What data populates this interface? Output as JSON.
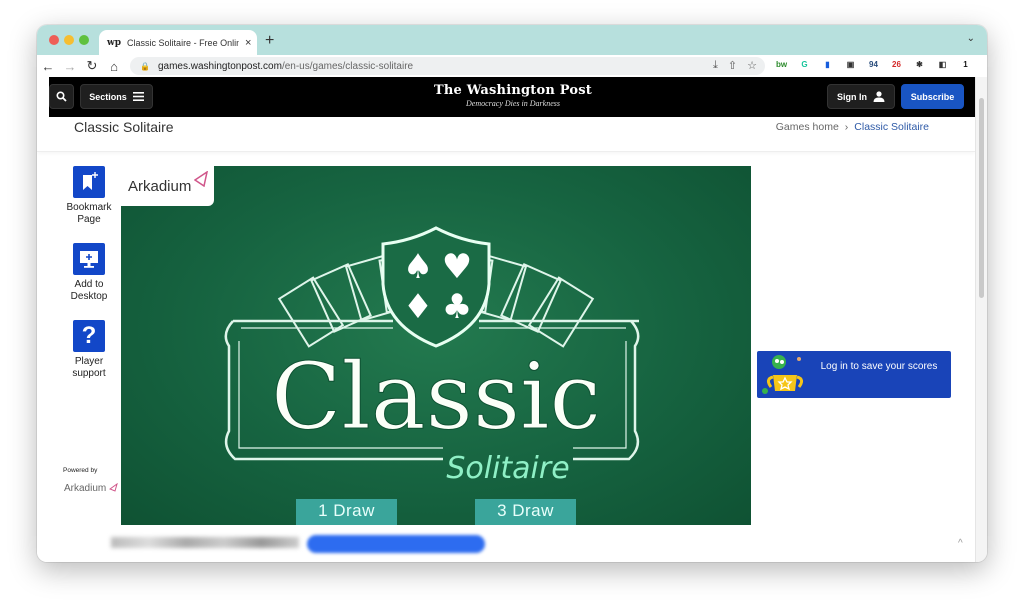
{
  "browser": {
    "tab_favicon": "wp",
    "tab_title": "Classic Solitaire - Free Online Game",
    "tab_close": "×",
    "new_tab": "+",
    "tab_menu": "⌄",
    "nav": {
      "back": "←",
      "forward": "→",
      "reload": "↻",
      "home": "⌂"
    },
    "url_host": "games.washingtonpost.com",
    "url_path": "/en-us/games/classic-solitaire",
    "omnibox_icons": [
      "download-icon",
      "share-icon",
      "bookmark-star-icon"
    ],
    "extensions": [
      {
        "name": "bw-extension-icon",
        "glyph": "bw",
        "color": "#2b8a2b"
      },
      {
        "name": "grammarly-extension-icon",
        "glyph": "G",
        "color": "#15c39a"
      },
      {
        "name": "bitwarden-extension-icon",
        "glyph": "▮",
        "color": "#175ddc"
      },
      {
        "name": "picture-in-picture-extension-icon",
        "glyph": "▣",
        "color": "#333333"
      },
      {
        "name": "calendar-extension-icon",
        "glyph": "94",
        "color": "#2a4d7c"
      },
      {
        "name": "adblock-extension-icon",
        "glyph": "26",
        "color": "#d42a2a"
      },
      {
        "name": "extensions-puzzle-icon",
        "glyph": "✱",
        "color": "#333333"
      },
      {
        "name": "side-panel-icon",
        "glyph": "◧",
        "color": "#333333"
      },
      {
        "name": "1password-extension-icon",
        "glyph": "1",
        "color": "#111111"
      }
    ],
    "menu": "⋮"
  },
  "header": {
    "sections_label": "Sections",
    "logo_name": "The Washington Post",
    "logo_tagline": "Democracy Dies in Darkness",
    "signin_label": "Sign In",
    "subscribe_label": "Subscribe"
  },
  "page": {
    "title": "Classic Solitaire",
    "breadcrumb": {
      "home": "Games home",
      "separator": "›",
      "current": "Classic Solitaire"
    }
  },
  "sidebar": {
    "items": [
      {
        "line1": "Bookmark",
        "line2": "Page"
      },
      {
        "line1": "Add to",
        "line2": "Desktop"
      },
      {
        "line1": "Player",
        "line2": "support"
      }
    ],
    "powered_by": "Powered by",
    "powered_logo": "Arkadium"
  },
  "game": {
    "badge": "Arkadium",
    "title": "Classic",
    "subtitle": "Solitaire",
    "buttons": [
      "1 Draw",
      "3 Draw"
    ],
    "suits": [
      "♠",
      "♥",
      "♦",
      "♣"
    ]
  },
  "login_banner": {
    "text": "Log in to save your scores"
  },
  "footer": {
    "up_chevron": "^"
  }
}
